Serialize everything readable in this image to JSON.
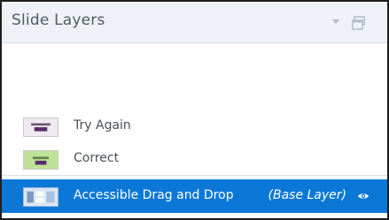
{
  "panel": {
    "title": "Slide Layers"
  },
  "layers": [
    {
      "label": "Try Again",
      "thumb_icon": "slide-thumbnail-icon",
      "selected": false
    },
    {
      "label": "Correct",
      "thumb_icon": "slide-thumbnail-icon",
      "selected": false
    },
    {
      "label": "Accessible Drag and Drop",
      "badge": "(Base Layer)",
      "thumb_icon": "slide-thumbnail-icon",
      "selected": true
    }
  ],
  "colors": {
    "header_bg": "#eef1f6",
    "selected_bg": "#0b78d7",
    "text": "#4a4f57"
  }
}
